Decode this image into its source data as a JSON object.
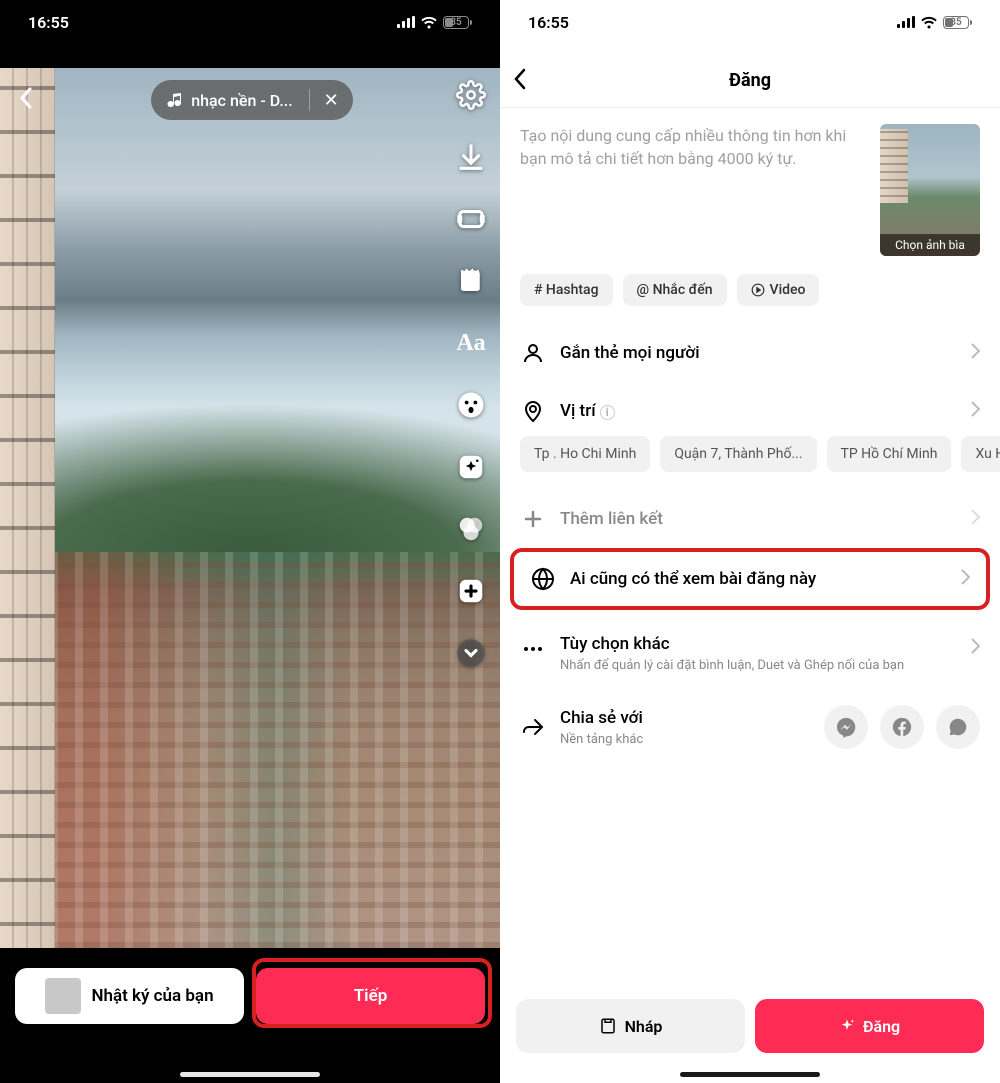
{
  "status": {
    "time": "16:55",
    "battery": "35"
  },
  "left": {
    "music_label": "nhạc nền - D...",
    "bottom": {
      "story_label": "Nhật ký của bạn",
      "next_label": "Tiếp"
    }
  },
  "right": {
    "title": "Đăng",
    "placeholder": "Tạo nội dung cung cấp nhiều thông tin hơn khi bạn mô tả chi tiết hơn bằng 4000 ký tự.",
    "cover_label": "Chọn ảnh bìa",
    "chips": {
      "hashtag": "# Hashtag",
      "mention": "@ Nhắc đến",
      "video": "Video"
    },
    "rows": {
      "tag_people": "Gắn thẻ mọi người",
      "location": "Vị trí",
      "add_link": "Thêm liên kết",
      "privacy": "Ai cũng có thể xem bài đăng này",
      "more_title": "Tùy chọn khác",
      "more_sub": "Nhấn để quản lý cài đặt bình luận, Duet và Ghép nối của bạn",
      "share_title": "Chia sẻ với",
      "share_sub": "Nền tảng khác"
    },
    "location_chips": [
      "Tp . Ho Chi Minh",
      "Quận 7, Thành Phố...",
      "TP Hồ Chí Minh",
      "Xu H"
    ],
    "bottom": {
      "draft": "Nháp",
      "post": "Đăng"
    }
  }
}
